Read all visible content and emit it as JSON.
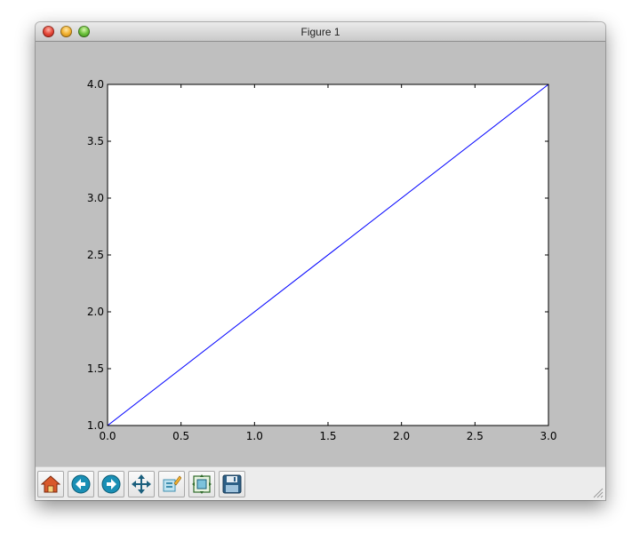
{
  "window": {
    "title": "Figure 1"
  },
  "toolbar": {
    "buttons": [
      {
        "name": "home",
        "icon": "home-icon"
      },
      {
        "name": "back",
        "icon": "back-arrow-icon"
      },
      {
        "name": "forward",
        "icon": "forward-arrow-icon"
      },
      {
        "name": "pan",
        "icon": "pan-arrows-icon"
      },
      {
        "name": "zoom-to-rect",
        "icon": "zoom-rect-icon"
      },
      {
        "name": "configure-subplots",
        "icon": "subplots-icon"
      },
      {
        "name": "save",
        "icon": "save-disk-icon"
      }
    ]
  },
  "chart_data": {
    "type": "line",
    "x": [
      0.0,
      3.0
    ],
    "series": [
      {
        "values": [
          1.0,
          4.0
        ],
        "color": "#0000ff"
      }
    ],
    "xlim": [
      0.0,
      3.0
    ],
    "ylim": [
      1.0,
      4.0
    ],
    "xticks": [
      "0.0",
      "0.5",
      "1.0",
      "1.5",
      "2.0",
      "2.5",
      "3.0"
    ],
    "yticks": [
      "1.0",
      "1.5",
      "2.0",
      "2.5",
      "3.0",
      "3.5",
      "4.0"
    ],
    "grid": false
  }
}
